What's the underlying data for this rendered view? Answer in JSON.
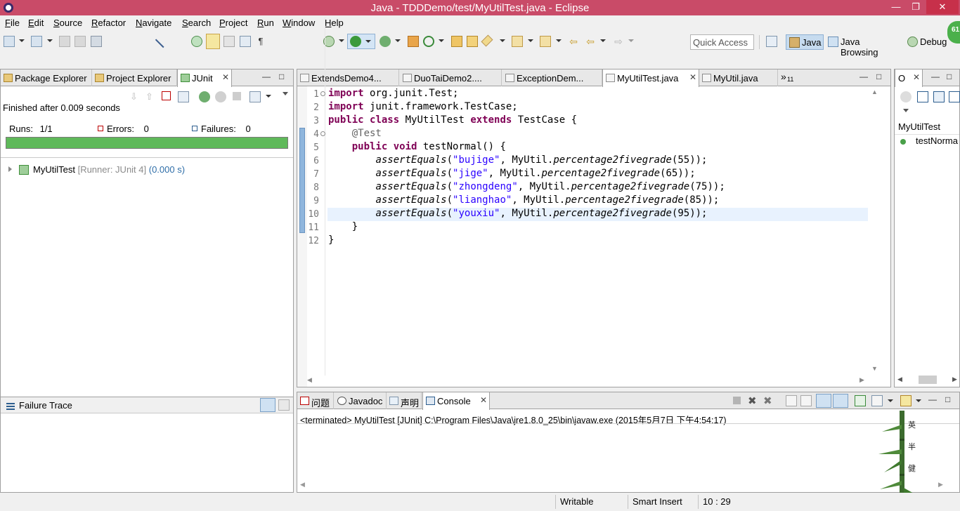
{
  "window": {
    "title": "Java - TDDDemo/test/MyUtilTest.java - Eclipse",
    "controls": {
      "minimize": "—",
      "maximize": "❐",
      "close": "✕"
    }
  },
  "menu": [
    "File",
    "Edit",
    "Source",
    "Refactor",
    "Navigate",
    "Search",
    "Project",
    "Run",
    "Window",
    "Help"
  ],
  "toolbar": {
    "quick_access_placeholder": "Quick Access",
    "perspectives": [
      {
        "label": "Java",
        "active": true
      },
      {
        "label": "Java Browsing",
        "active": false
      },
      {
        "label": "Debug",
        "active": false
      }
    ],
    "badge": "61"
  },
  "left_panel": {
    "tabs": [
      {
        "label": "Package Explorer",
        "active": false
      },
      {
        "label": "Project Explorer",
        "active": false
      },
      {
        "label": "JUnit",
        "active": true
      }
    ],
    "tab_close": "✕",
    "min_icon": "—",
    "max_icon": "□",
    "junit": {
      "finished": "Finished after 0.009 seconds",
      "runs_label": "Runs:",
      "runs_value": "1/1",
      "errors_label": "Errors:",
      "errors_value": "0",
      "failures_label": "Failures:",
      "failures_value": "0",
      "progress": 1.0,
      "progress_color": "#5fb95a",
      "tree": {
        "name": "MyUtilTest",
        "runner": "[Runner: JUnit 4]",
        "time": "(0.000 s)"
      }
    },
    "failure_trace": {
      "label": "Failure Trace"
    }
  },
  "editor": {
    "tabs": [
      {
        "label": "ExtendsDemo4...",
        "active": false
      },
      {
        "label": "DuoTaiDemo2....",
        "active": false
      },
      {
        "label": "ExceptionDem...",
        "active": false
      },
      {
        "label": "MyUtilTest.java",
        "active": true
      },
      {
        "label": "MyUtil.java",
        "active": false
      }
    ],
    "tab_close": "✕",
    "overflow": "»",
    "overflow_count": "11",
    "line_numbers": [
      "1",
      "2",
      "3",
      "4",
      "5",
      "6",
      "7",
      "8",
      "9",
      "10",
      "11",
      "12"
    ],
    "lines": {
      "l1_kw": "import",
      "l1_rest": " org.junit.Test;",
      "l2_kw": "import",
      "l2_rest": " junit.framework.TestCase;",
      "l3_kw1": "public",
      "l3_kw2": "class",
      "l3_name": " MyUtilTest ",
      "l3_kw3": "extends",
      "l3_rest": " TestCase {",
      "l4_ann": "@Test",
      "l5_kw1": "public",
      "l5_kw2": "void",
      "l5_rest": " testNormal() {",
      "assert_fn": "assertEquals",
      "util_call": "percentage2fivegrade",
      "l6_str": "\"bujige\"",
      "l6_num": "55",
      "l7_str": "\"jige\"",
      "l7_num": "65",
      "l8_str": "\"zhongdeng\"",
      "l8_num": "75",
      "l9_str": "\"lianghao\"",
      "l9_num": "85",
      "l10_str": "\"youxiu\"",
      "l10_num": "95",
      "l11": "}",
      "l12": "}"
    }
  },
  "outline": {
    "tab_label": "O",
    "item_class": "MyUtilTest",
    "item_method": "testNorma"
  },
  "console_panel": {
    "tabs": [
      {
        "label": "问题",
        "active": false
      },
      {
        "label": "Javadoc",
        "active": false
      },
      {
        "label": "声明",
        "active": false
      },
      {
        "label": "Console",
        "active": true
      }
    ],
    "tab_close": "✕",
    "status": "<terminated> MyUtilTest [JUnit] C:\\Program Files\\Java\\jre1.8.0_25\\bin\\javaw.exe (2015年5月7日 下午4:54:17)"
  },
  "statusbar": {
    "writable": "Writable",
    "insert_mode": "Smart Insert",
    "position": "10 : 29"
  },
  "decoration": {
    "chars": [
      "英",
      "半",
      "健"
    ]
  },
  "colors": {
    "titlebar": "#c94b68",
    "keyword": "#7f0055",
    "string": "#2a00ff",
    "progress_green": "#5fb95a"
  }
}
